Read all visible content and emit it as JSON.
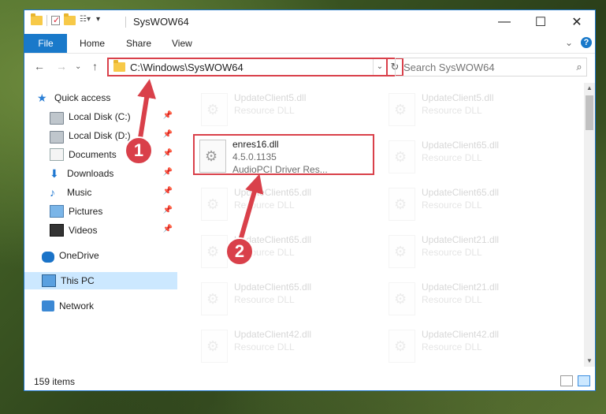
{
  "window": {
    "title": "SysWOW64",
    "controls": {
      "minimize": "—",
      "maximize": "☐",
      "close": "✕"
    }
  },
  "ribbon": {
    "file": "File",
    "tabs": [
      "Home",
      "Share",
      "View"
    ],
    "help": "?",
    "collapse": "⌄"
  },
  "nav": {
    "back": "←",
    "forward": "→",
    "recent": "⌄",
    "up": "↑",
    "address": "C:\\Windows\\SysWOW64",
    "address_drop": "⌄",
    "refresh": "↻",
    "search_placeholder": "Search SysWOW64",
    "search_icon": "⌕"
  },
  "sidebar": {
    "items": [
      {
        "label": "Quick access",
        "icon": "star-icon"
      },
      {
        "label": "Local Disk (C:)",
        "icon": "drive-icon",
        "pinned": true
      },
      {
        "label": "Local Disk (D:)",
        "icon": "drive-icon",
        "pinned": true
      },
      {
        "label": "Documents",
        "icon": "documents-icon",
        "pinned": true
      },
      {
        "label": "Downloads",
        "icon": "download-icon",
        "pinned": true
      },
      {
        "label": "Music",
        "icon": "music-icon",
        "pinned": true
      },
      {
        "label": "Pictures",
        "icon": "pictures-icon",
        "pinned": true
      },
      {
        "label": "Videos",
        "icon": "videos-icon",
        "pinned": true
      },
      {
        "label": "OneDrive",
        "icon": "onedrive-icon"
      },
      {
        "label": "This PC",
        "icon": "this-pc-icon",
        "selected": true
      },
      {
        "label": "Network",
        "icon": "network-icon"
      }
    ],
    "pin_glyph": "📌"
  },
  "files": {
    "highlighted": {
      "name": "enres16.dll",
      "version": "4.5.0.1135",
      "description": "AudioPCI Driver Res..."
    },
    "left_column": [
      {
        "name": "UpdateClient5.dll",
        "type": "Resource DLL"
      },
      {
        "name": "UpdateClient65.dll",
        "type": "Resource DLL"
      },
      {
        "name": "UpdateClient65.dll",
        "type": "Resource DLL"
      },
      {
        "name": "UpdateClient65.dll",
        "type": "Resource DLL"
      },
      {
        "name": "UpdateClient42.dll",
        "type": "Resource DLL"
      }
    ],
    "right_column": [
      {
        "name": "UpdateClient5.dll",
        "type": "Resource DLL"
      },
      {
        "name": "UpdateClient65.dll",
        "type": "Resource DLL"
      },
      {
        "name": "UpdateClient65.dll",
        "type": "Resource DLL"
      },
      {
        "name": "UpdateClient21.dll",
        "type": "Resource DLL"
      },
      {
        "name": "UpdateClient21.dll",
        "type": "Resource DLL"
      },
      {
        "name": "UpdateClient42.dll",
        "type": "Resource DLL"
      }
    ]
  },
  "status": {
    "item_count": "159 items"
  },
  "callouts": {
    "one": "1",
    "two": "2",
    "color": "#d9404a"
  }
}
